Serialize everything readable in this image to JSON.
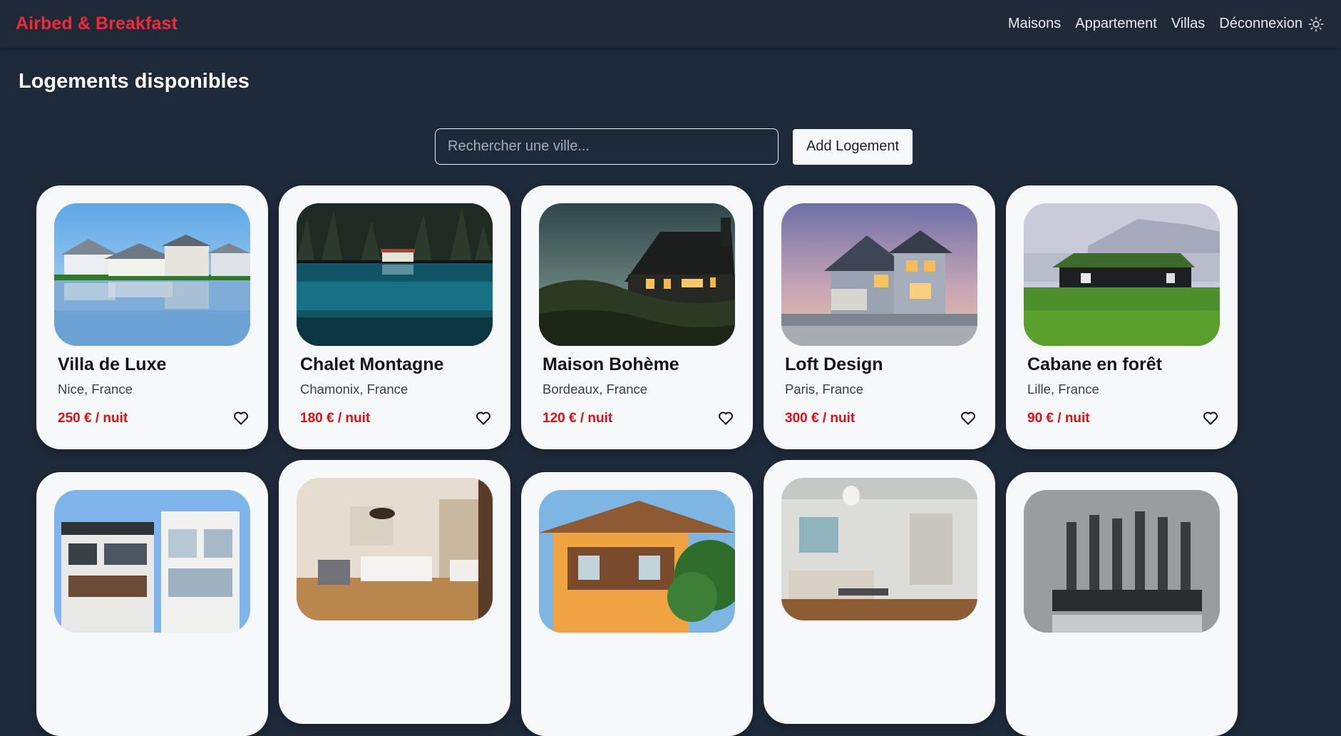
{
  "brand": "Airbed & Breakfast",
  "nav": {
    "items": [
      "Maisons",
      "Appartement",
      "Villas",
      "Déconnexion"
    ],
    "theme_toggle_icon": "sun-icon"
  },
  "page_title": "Logements disponibles",
  "search": {
    "placeholder": "Rechercher une ville...",
    "value": ""
  },
  "add_button_label": "Add Logement",
  "colors": {
    "brand": "#ef2b3a",
    "background": "#1e2939",
    "card": "#f7f8fa",
    "price": "#e00d14"
  },
  "listings": [
    {
      "title": "Villa de Luxe",
      "location": "Nice, France",
      "price": "250 € / nuit",
      "photo": "waterfront-villas",
      "favorite_icon": "heart-outline-icon"
    },
    {
      "title": "Chalet Montagne",
      "location": "Chamonix, France",
      "price": "180 € / nuit",
      "photo": "lake-chalet",
      "favorite_icon": "heart-outline-icon"
    },
    {
      "title": "Maison Bohème",
      "location": "Bordeaux, France",
      "price": "120 € / nuit",
      "photo": "cottage-at-dusk",
      "favorite_icon": "heart-outline-icon"
    },
    {
      "title": "Loft Design",
      "location": "Paris, France",
      "price": "300 € / nuit",
      "photo": "suburban-house",
      "favorite_icon": "heart-outline-icon"
    },
    {
      "title": "Cabane en forêt",
      "location": "Lille, France",
      "price": "90 € / nuit",
      "photo": "grass-roof-cabin",
      "favorite_icon": "heart-outline-icon"
    },
    {
      "photo": "modern-building"
    },
    {
      "photo": "hotel-room"
    },
    {
      "photo": "orange-bungalow"
    },
    {
      "photo": "living-room"
    },
    {
      "photo": "screws"
    }
  ]
}
